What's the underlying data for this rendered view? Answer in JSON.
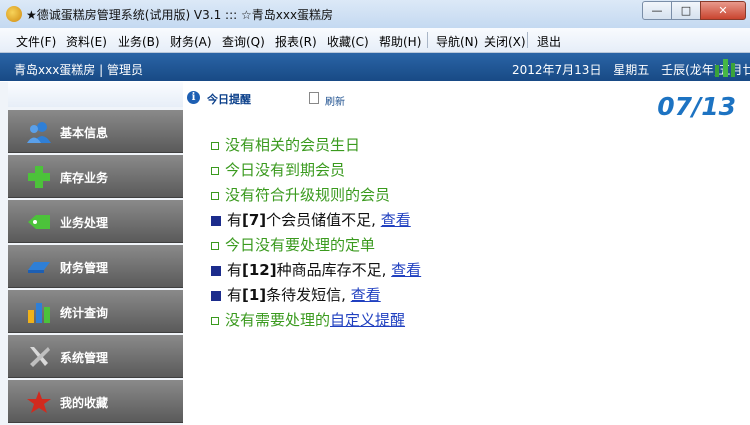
{
  "window": {
    "title": "★德诚蛋糕房管理系统(试用版) V3.1  ::: ☆青岛xxx蛋糕房"
  },
  "menu": {
    "items": [
      "文件(F)",
      "资料(E)",
      "业务(B)",
      "财务(A)",
      "查询(Q)",
      "报表(R)",
      "收藏(C)",
      "帮助(H)",
      "导航(N)",
      "关闭(X)",
      "退出"
    ]
  },
  "infobar": {
    "store_user": "青岛xxx蛋糕房 | 管理员",
    "date": "2012年7月13日",
    "weekday": "星期五",
    "lunar": "壬辰(龙年)五月廿五"
  },
  "sidebar": {
    "items": [
      {
        "label": "基本信息",
        "icon": "users-icon"
      },
      {
        "label": "库存业务",
        "icon": "plus-icon"
      },
      {
        "label": "业务处理",
        "icon": "tag-icon"
      },
      {
        "label": "财务管理",
        "icon": "card-icon"
      },
      {
        "label": "统计查询",
        "icon": "bar-chart-icon"
      },
      {
        "label": "系统管理",
        "icon": "tools-icon"
      },
      {
        "label": "我的收藏",
        "icon": "star-icon"
      }
    ]
  },
  "toolbar": {
    "today_label": "今日提醒",
    "refresh_label": "刷新",
    "date_big": "07/13"
  },
  "reminders": {
    "r1": "没有相关的会员生日",
    "r2": "今日没有到期会员",
    "r3": "没有符合升级规则的会员",
    "r4_pre": "有",
    "r4_num": "[7]",
    "r4_post": "个会员储值不足, ",
    "r4_link": "查看",
    "r5": "今日没有要处理的定单",
    "r6_pre": "有",
    "r6_num": "[12]",
    "r6_post": "种商品库存不足, ",
    "r6_link": "查看",
    "r7_pre": "有",
    "r7_num": "[1]",
    "r7_post": "条待发短信, ",
    "r7_link": "查看",
    "r8_pre": "没有需要处理的",
    "r8_link": "自定义提醒"
  },
  "colors": {
    "infobar_bg": "#1f5596",
    "ok_text": "#3a9a1e",
    "warn_bullet": "#1c2c8c",
    "date_big": "#1d73c2",
    "link": "#2040c0"
  }
}
